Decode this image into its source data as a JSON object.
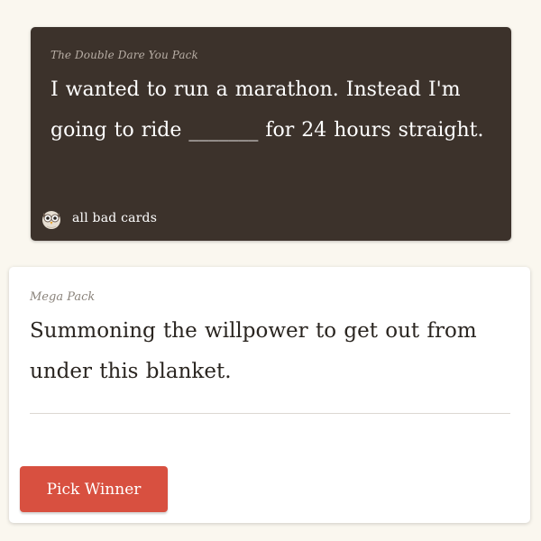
{
  "black_card": {
    "pack_name": "The Double Dare You Pack",
    "prompt_text": "I wanted to run a marathon. Instead I'm going to ride _______ for 24 hours straight.",
    "owner_icon": "owl-icon",
    "owner_name": "all bad cards"
  },
  "white_card": {
    "pack_name": "Mega Pack",
    "answer_text": "Summoning the willpower to get out from under this blanket.",
    "pick_button_label": "Pick Winner"
  },
  "colors": {
    "background": "#faf7ef",
    "black_card": "#3c322b",
    "white_card": "#ffffff",
    "pick_button": "#d85040"
  }
}
